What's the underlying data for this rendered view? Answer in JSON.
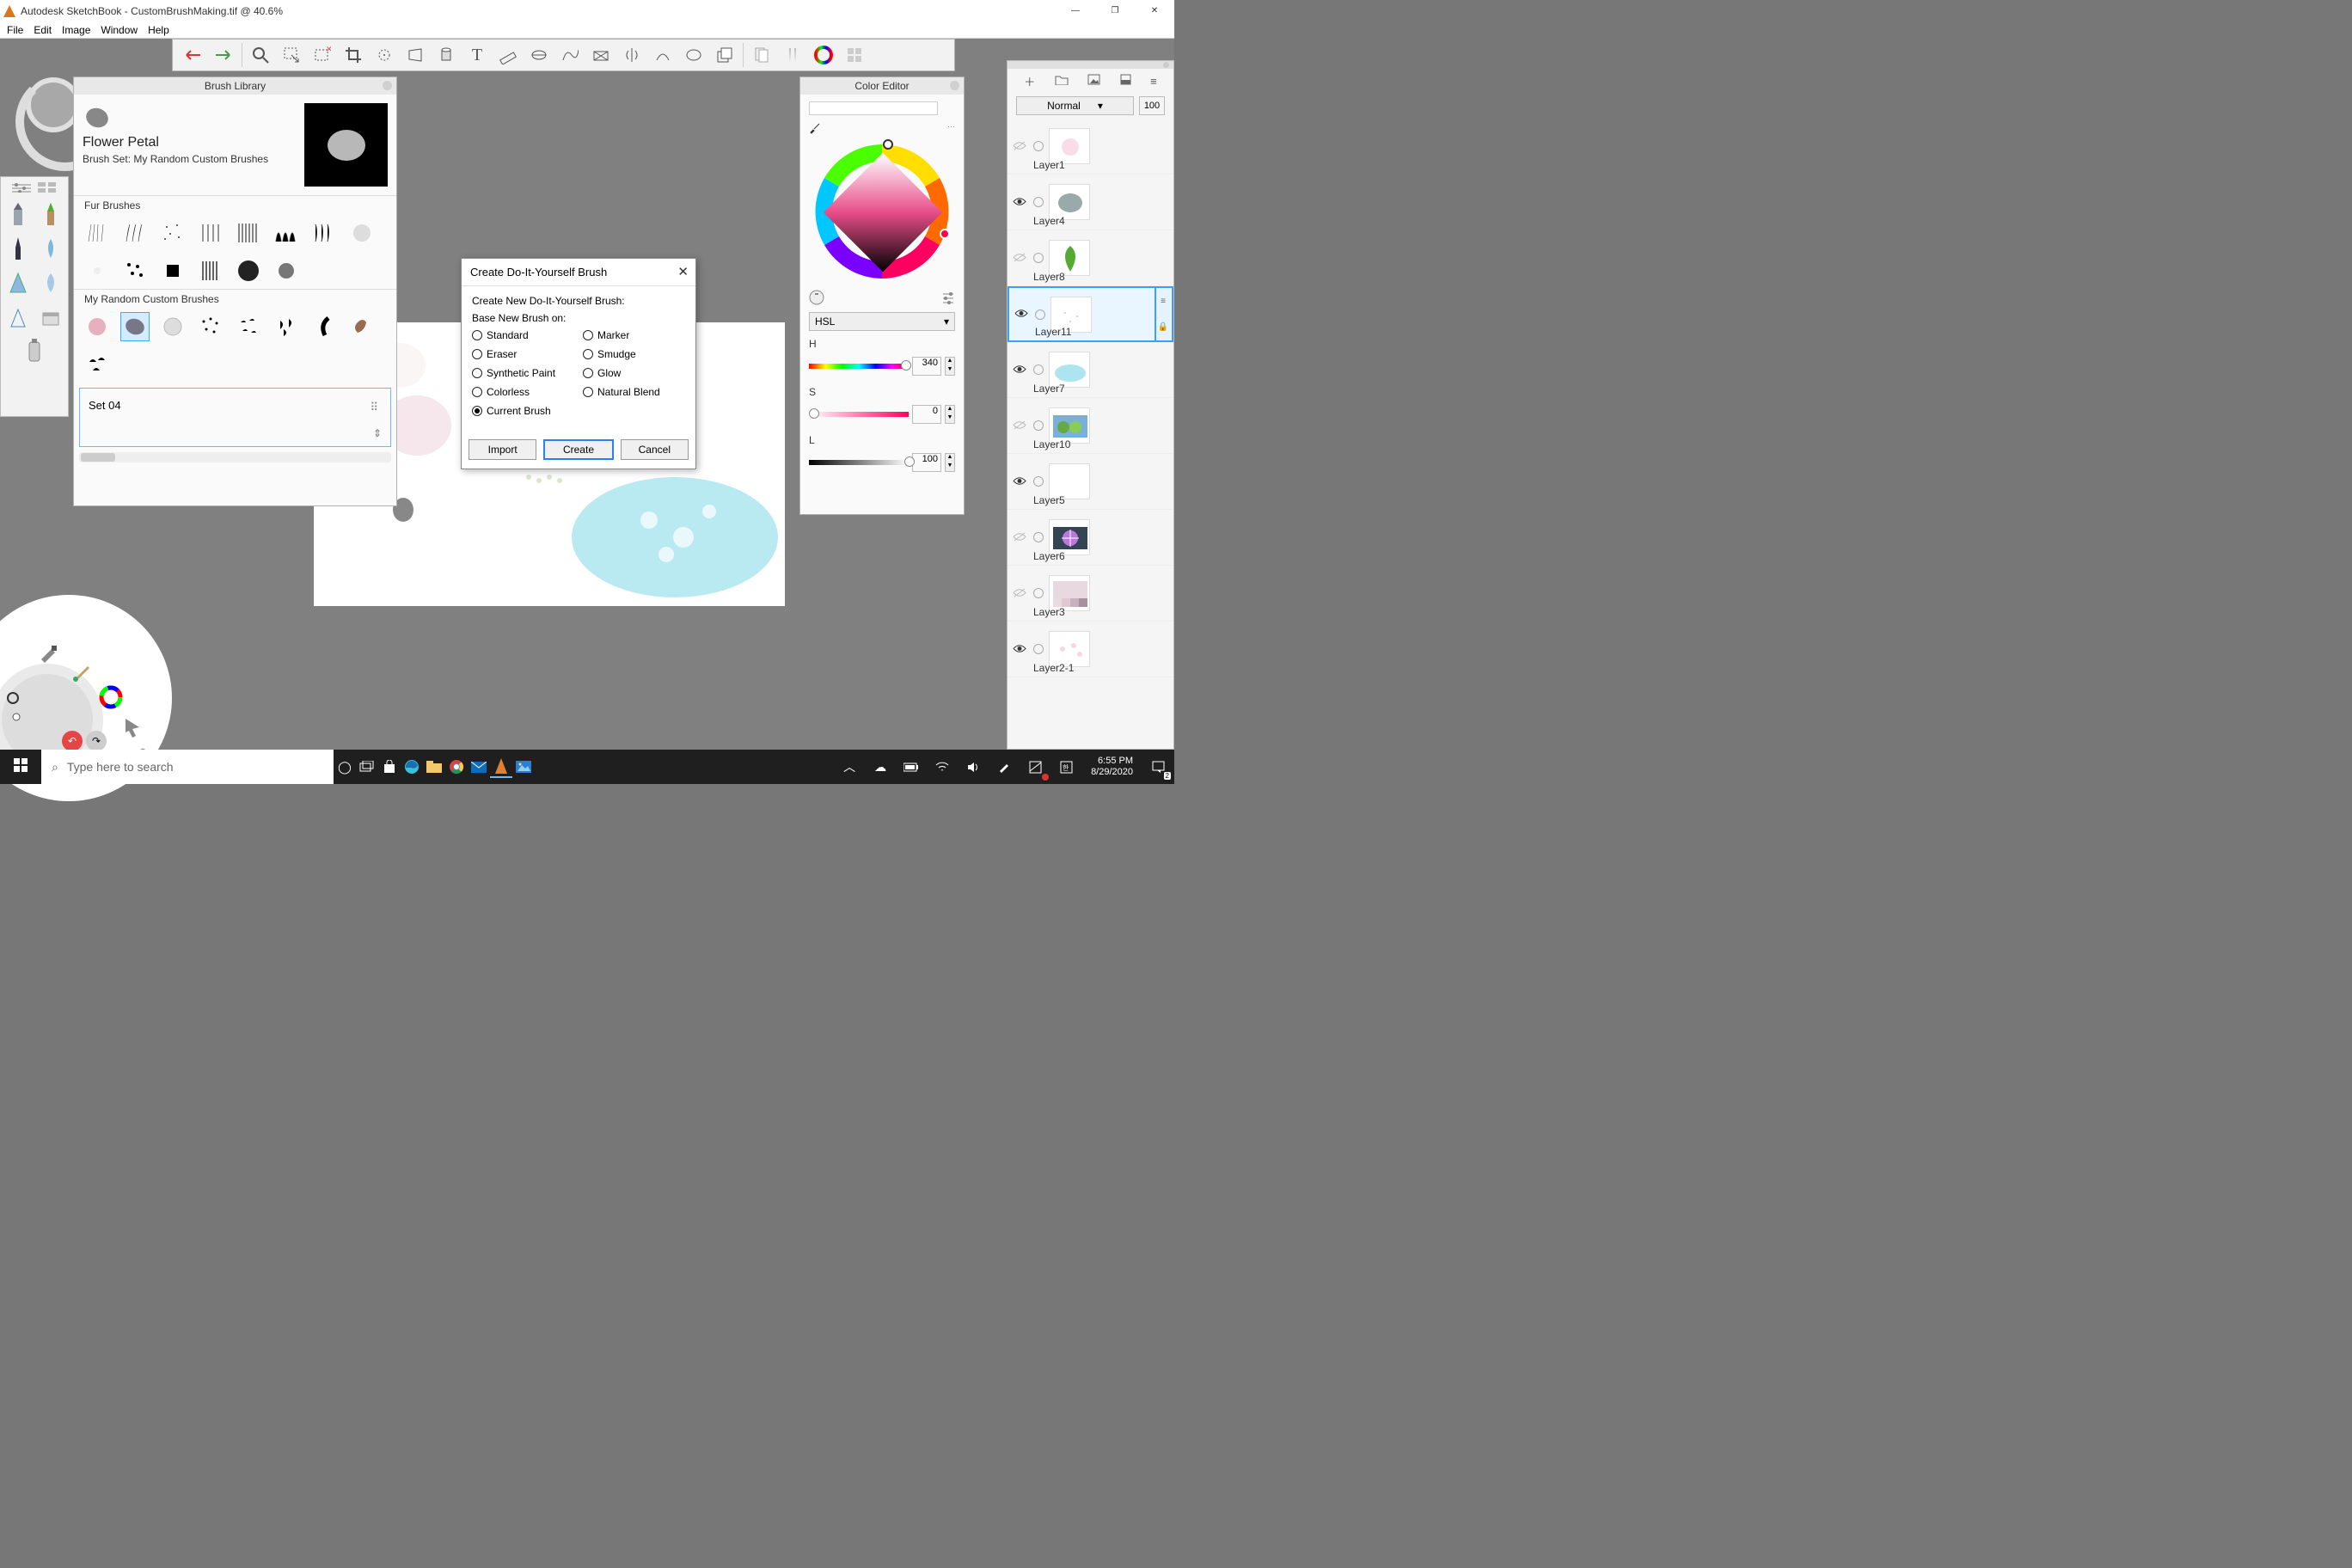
{
  "window": {
    "title": "Autodesk SketchBook - CustomBrushMaking.tif @ 40.6%"
  },
  "menu": {
    "items": [
      "File",
      "Edit",
      "Image",
      "Window",
      "Help"
    ]
  },
  "brush_library": {
    "title": "Brush Library",
    "brush_name": "Flower Petal",
    "brush_set_prefix": "Brush Set: ",
    "brush_set_name": "My Random Custom Brushes",
    "sections": {
      "fur": "Fur Brushes",
      "custom": "My Random Custom Brushes"
    },
    "active_set": "Set 04"
  },
  "dialog": {
    "title": "Create Do-It-Yourself Brush",
    "sub1": "Create New Do-It-Yourself Brush:",
    "sub2": "Base New Brush on:",
    "options": [
      "Standard",
      "Marker",
      "Eraser",
      "Smudge",
      "Synthetic Paint",
      "Glow",
      "Colorless",
      "Natural Blend",
      "Current Brush"
    ],
    "selected": "Current Brush",
    "btn_import": "Import",
    "btn_create": "Create",
    "btn_cancel": "Cancel"
  },
  "color_editor": {
    "title": "Color Editor",
    "mode": "HSL",
    "h_label": "H",
    "h_value": "340",
    "s_label": "S",
    "s_value": "0",
    "l_label": "L",
    "l_value": "100"
  },
  "layers": {
    "blend_mode": "Normal",
    "opacity": "100",
    "items": [
      {
        "name": "Layer1",
        "visible": false
      },
      {
        "name": "Layer4",
        "visible": true
      },
      {
        "name": "Layer8",
        "visible": false
      },
      {
        "name": "Layer11",
        "visible": true,
        "selected": true
      },
      {
        "name": "Layer7",
        "visible": true
      },
      {
        "name": "Layer10",
        "visible": false
      },
      {
        "name": "Layer5",
        "visible": true
      },
      {
        "name": "Layer6",
        "visible": false
      },
      {
        "name": "Layer3",
        "visible": false
      },
      {
        "name": "Layer2-1",
        "visible": true
      }
    ]
  },
  "taskbar": {
    "search_placeholder": "Type here to search",
    "time": "6:55 PM",
    "date": "8/29/2020",
    "notif": "2"
  }
}
